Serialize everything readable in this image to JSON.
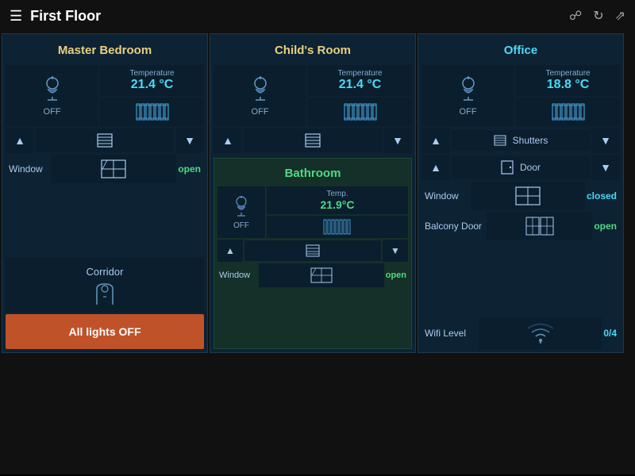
{
  "header": {
    "title": "First Floor",
    "icons": [
      "chat-icon",
      "refresh-icon",
      "expand-icon"
    ]
  },
  "rooms": {
    "master_bedroom": {
      "title": "Master Bedroom",
      "title_color": "yellow",
      "light": {
        "status": "OFF",
        "label": "OFF"
      },
      "temperature": {
        "label": "Temperature",
        "value": "21.4 °C"
      },
      "shutter_label": "Shutters",
      "window_label": "Window",
      "window_status": "open"
    },
    "childs_room": {
      "title": "Child's Room",
      "title_color": "yellow",
      "light": {
        "status": "OFF",
        "label": "OFF"
      },
      "temperature": {
        "label": "Temperature",
        "value": "21.4 °C"
      }
    },
    "office": {
      "title": "Office",
      "title_color": "cyan",
      "light": {
        "status": "OFF",
        "label": "OFF"
      },
      "temperature": {
        "label": "Temperature",
        "value": "18.8 °C"
      },
      "shutter_label": "Shutters",
      "door_label": "Door",
      "window_label": "Window",
      "window_status": "closed",
      "balcony_label": "Balcony Door",
      "balcony_status": "open",
      "wifi_label": "Wifi Level",
      "wifi_value": "0/4"
    },
    "bathroom": {
      "title": "Bathroom",
      "title_color": "green",
      "light": {
        "status": "OFF",
        "label": "OFF"
      },
      "temperature": {
        "label": "Temp.",
        "value": "21.9°C"
      },
      "window_label": "Window",
      "window_status": "open"
    },
    "corridor": {
      "title": "Corridor"
    }
  },
  "buttons": {
    "all_lights_off": "All lights OFF",
    "up": "▲",
    "down": "▼"
  }
}
